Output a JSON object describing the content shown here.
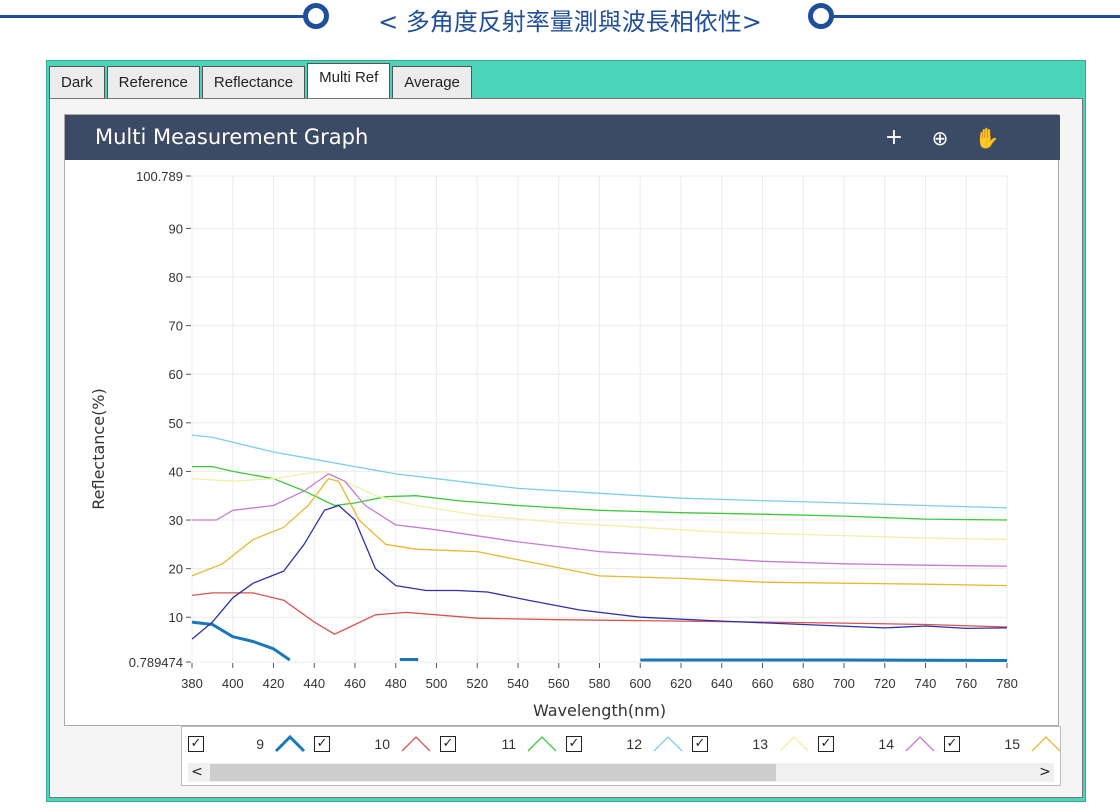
{
  "header": {
    "title": "< 多角度反射率量測與波長相依性>"
  },
  "tabs": [
    {
      "label": "Dark",
      "active": false
    },
    {
      "label": "Reference",
      "active": false
    },
    {
      "label": "Reflectance",
      "active": false
    },
    {
      "label": "Multi Ref",
      "active": true
    },
    {
      "label": "Average",
      "active": false
    }
  ],
  "graph": {
    "title": "Multi Measurement Graph",
    "tools": [
      {
        "name": "crosshair-icon",
        "glyph": "+"
      },
      {
        "name": "zoom-icon",
        "glyph": "⊕"
      },
      {
        "name": "pan-hand-icon",
        "glyph": "✋"
      }
    ]
  },
  "legend": {
    "items": [
      {
        "num": "9",
        "color": "#1a78b8",
        "checked": true
      },
      {
        "num": "10",
        "color": "#d9534f",
        "checked": true
      },
      {
        "num": "11",
        "color": "#3ec83e",
        "checked": true
      },
      {
        "num": "12",
        "color": "#7ccfe8",
        "checked": true
      },
      {
        "num": "13",
        "color": "#f0f0a8",
        "checked": true
      },
      {
        "num": "14",
        "color": "#c77ad6",
        "checked": true
      },
      {
        "num": "15",
        "color": "#e8b830",
        "checked": true
      }
    ],
    "scroll_left": "<",
    "scroll_right": ">"
  },
  "chart_data": {
    "type": "line",
    "xlabel": "Wavelength(nm)",
    "ylabel": "Reflectance(%)",
    "xlim": [
      380,
      780
    ],
    "ylim": [
      0.789474,
      100.789
    ],
    "xticks": [
      380,
      400,
      420,
      440,
      460,
      480,
      500,
      520,
      540,
      560,
      580,
      600,
      620,
      640,
      660,
      680,
      700,
      720,
      740,
      760,
      780
    ],
    "yticks": [
      {
        "value": 0.789474,
        "label": "0.789474"
      },
      {
        "value": 10,
        "label": "10"
      },
      {
        "value": 20,
        "label": "20"
      },
      {
        "value": 30,
        "label": "30"
      },
      {
        "value": 40,
        "label": "40"
      },
      {
        "value": 50,
        "label": "50"
      },
      {
        "value": 60,
        "label": "60"
      },
      {
        "value": 70,
        "label": "70"
      },
      {
        "value": 80,
        "label": "80"
      },
      {
        "value": 90,
        "label": "90"
      },
      {
        "value": 100.789,
        "label": "100.789"
      }
    ],
    "grid": true,
    "series": [
      {
        "name": "9",
        "color": "#1a78b8",
        "width": 3,
        "segments": [
          [
            [
              380,
              9
            ],
            [
              390,
              8.5
            ],
            [
              400,
              6
            ],
            [
              410,
              5
            ],
            [
              420,
              3.5
            ],
            [
              428,
              1.2
            ]
          ],
          [
            [
              482,
              1.3
            ],
            [
              491,
              1.3
            ]
          ],
          [
            [
              600,
              1.2
            ],
            [
              700,
              1.2
            ],
            [
              780,
              1.1
            ]
          ]
        ]
      },
      {
        "name": "10",
        "color": "#d9534f",
        "width": 1.3,
        "segments": [
          [
            [
              380,
              14.5
            ],
            [
              390,
              15
            ],
            [
              410,
              15
            ],
            [
              425,
              13.5
            ],
            [
              440,
              9
            ],
            [
              450,
              6.5
            ],
            [
              460,
              8.5
            ],
            [
              470,
              10.5
            ],
            [
              485,
              11
            ],
            [
              500,
              10.5
            ],
            [
              520,
              9.8
            ],
            [
              560,
              9.5
            ],
            [
              600,
              9.3
            ],
            [
              640,
              9.1
            ],
            [
              700,
              8.8
            ],
            [
              740,
              8.5
            ],
            [
              780,
              8
            ]
          ]
        ]
      },
      {
        "name": "11",
        "color": "#3ec83e",
        "width": 1.3,
        "segments": [
          [
            [
              380,
              41
            ],
            [
              390,
              41
            ],
            [
              400,
              40
            ],
            [
              420,
              38.5
            ],
            [
              435,
              36
            ],
            [
              450,
              33
            ],
            [
              460,
              33.5
            ],
            [
              475,
              34.8
            ],
            [
              490,
              35
            ],
            [
              510,
              34
            ],
            [
              540,
              33
            ],
            [
              580,
              32
            ],
            [
              620,
              31.5
            ],
            [
              660,
              31.2
            ],
            [
              700,
              30.8
            ],
            [
              740,
              30.2
            ],
            [
              780,
              30
            ]
          ]
        ]
      },
      {
        "name": "12",
        "color": "#7ccfe8",
        "width": 1.3,
        "segments": [
          [
            [
              380,
              47.5
            ],
            [
              390,
              47
            ],
            [
              400,
              46
            ],
            [
              420,
              44
            ],
            [
              440,
              42.5
            ],
            [
              460,
              41
            ],
            [
              480,
              39.5
            ],
            [
              500,
              38.5
            ],
            [
              540,
              36.5
            ],
            [
              580,
              35.5
            ],
            [
              620,
              34.5
            ],
            [
              660,
              34
            ],
            [
              700,
              33.5
            ],
            [
              740,
              33
            ],
            [
              780,
              32.5
            ]
          ]
        ]
      },
      {
        "name": "13",
        "color": "#f0f0a8",
        "width": 1.3,
        "segments": [
          [
            [
              380,
              38.5
            ],
            [
              400,
              38
            ],
            [
              420,
              38.5
            ],
            [
              435,
              39.5
            ],
            [
              445,
              40
            ],
            [
              455,
              38
            ],
            [
              470,
              35
            ],
            [
              490,
              33
            ],
            [
              520,
              31
            ],
            [
              560,
              29.5
            ],
            [
              600,
              28.5
            ],
            [
              640,
              27.5
            ],
            [
              700,
              26.8
            ],
            [
              740,
              26.3
            ],
            [
              780,
              26
            ]
          ]
        ]
      },
      {
        "name": "14",
        "color": "#c77ad6",
        "width": 1.3,
        "segments": [
          [
            [
              380,
              30
            ],
            [
              392,
              30
            ],
            [
              400,
              32
            ],
            [
              420,
              33
            ],
            [
              435,
              36
            ],
            [
              447,
              39.5
            ],
            [
              455,
              38
            ],
            [
              465,
              33
            ],
            [
              480,
              29
            ],
            [
              500,
              28
            ],
            [
              540,
              25.5
            ],
            [
              580,
              23.5
            ],
            [
              620,
              22.5
            ],
            [
              660,
              21.5
            ],
            [
              700,
              21
            ],
            [
              740,
              20.7
            ],
            [
              780,
              20.5
            ]
          ]
        ]
      },
      {
        "name": "15",
        "color": "#e8b830",
        "width": 1.3,
        "segments": [
          [
            [
              380,
              18.5
            ],
            [
              395,
              21
            ],
            [
              410,
              26
            ],
            [
              425,
              28.5
            ],
            [
              437,
              33
            ],
            [
              447,
              38.5
            ],
            [
              452,
              38
            ],
            [
              462,
              30
            ],
            [
              475,
              25
            ],
            [
              490,
              24
            ],
            [
              520,
              23.5
            ],
            [
              550,
              21
            ],
            [
              580,
              18.5
            ],
            [
              620,
              18
            ],
            [
              660,
              17.2
            ],
            [
              700,
              17
            ],
            [
              740,
              16.8
            ],
            [
              780,
              16.5
            ]
          ]
        ]
      },
      {
        "name": "",
        "color": "#3030a8",
        "width": 1.3,
        "segments": [
          [
            [
              380,
              5.5
            ],
            [
              390,
              9
            ],
            [
              400,
              14
            ],
            [
              410,
              17
            ],
            [
              425,
              19.5
            ],
            [
              435,
              25
            ],
            [
              445,
              32
            ],
            [
              452,
              33
            ],
            [
              460,
              30
            ],
            [
              470,
              20
            ],
            [
              480,
              16.5
            ],
            [
              495,
              15.5
            ],
            [
              510,
              15.5
            ],
            [
              525,
              15.2
            ],
            [
              545,
              13.5
            ],
            [
              570,
              11.5
            ],
            [
              600,
              10
            ],
            [
              640,
              9.2
            ],
            [
              680,
              8.5
            ],
            [
              720,
              7.8
            ],
            [
              740,
              8.2
            ],
            [
              760,
              7.7
            ],
            [
              780,
              7.8
            ]
          ]
        ]
      }
    ]
  }
}
